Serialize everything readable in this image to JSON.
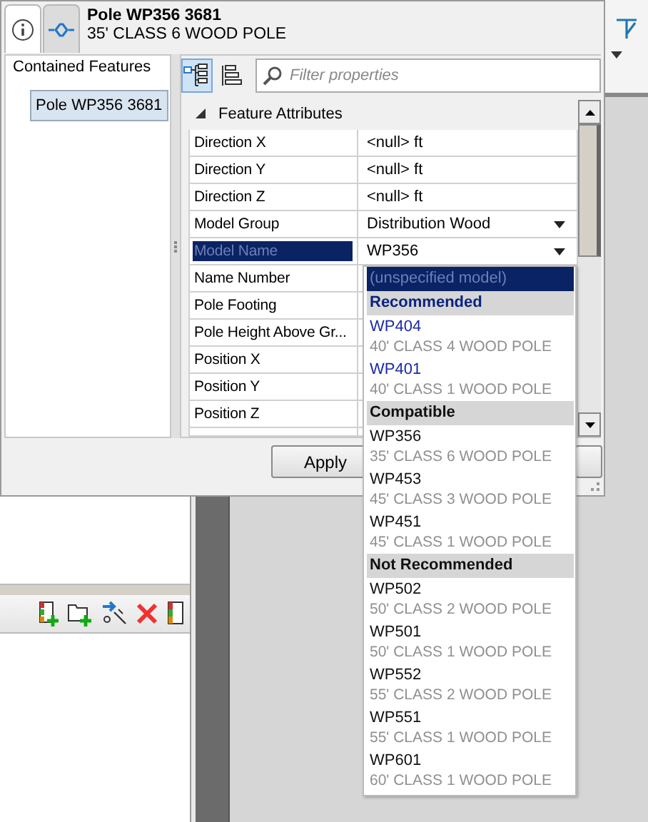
{
  "window": {
    "title": "Pole WP356 3681",
    "subtitle": "35' CLASS 6 WOOD POLE"
  },
  "tabs": [
    {
      "kind": "info",
      "selected": true
    },
    {
      "kind": "connection",
      "selected": false
    }
  ],
  "contained_features": {
    "title": "Contained Features",
    "items": [
      {
        "label": "Pole WP356 3681",
        "selected": true
      }
    ]
  },
  "view_buttons": [
    {
      "kind": "categorized",
      "selected": true
    },
    {
      "kind": "alphabetical",
      "selected": false
    }
  ],
  "filter": {
    "placeholder": "Filter properties"
  },
  "section": {
    "title": "Feature Attributes",
    "expanded": true
  },
  "properties": [
    {
      "name": "Direction X",
      "value": "<null> ft",
      "kind": "text",
      "selected": false
    },
    {
      "name": "Direction Y",
      "value": "<null> ft",
      "kind": "text",
      "selected": false
    },
    {
      "name": "Direction Z",
      "value": "<null> ft",
      "kind": "text",
      "selected": false
    },
    {
      "name": "Model Group",
      "value": "Distribution Wood",
      "kind": "dropdown",
      "selected": false
    },
    {
      "name": "Model Name",
      "value": "WP356",
      "kind": "dropdown",
      "selected": true
    },
    {
      "name": "Name Number",
      "kind": "text",
      "selected": false
    },
    {
      "name": "Pole Footing",
      "kind": "text",
      "selected": false
    },
    {
      "name": "Pole Height Above Gr...",
      "kind": "text",
      "selected": false
    },
    {
      "name": "Position X",
      "kind": "text",
      "selected": false
    },
    {
      "name": "Position Y",
      "kind": "text",
      "selected": false
    },
    {
      "name": "Position Z",
      "kind": "text",
      "selected": false
    }
  ],
  "buttons": [
    {
      "label": "Apply"
    }
  ],
  "dropdown": {
    "items": [
      {
        "kind": "option",
        "label": "(unspecified model)",
        "selected": true
      },
      {
        "kind": "header",
        "label": "Recommended",
        "recommended": true
      },
      {
        "kind": "model",
        "name": "WP404",
        "description": "40' CLASS 4 WOOD POLE",
        "recommended": true,
        "selected": false
      },
      {
        "kind": "model",
        "name": "WP401",
        "description": "40' CLASS 1 WOOD POLE",
        "recommended": true,
        "selected": false
      },
      {
        "kind": "header",
        "label": "Compatible",
        "recommended": false
      },
      {
        "kind": "model",
        "name": "WP356",
        "description": "35' CLASS 6 WOOD POLE",
        "recommended": false,
        "selected": false
      },
      {
        "kind": "model",
        "name": "WP453",
        "description": "45' CLASS 3 WOOD POLE",
        "recommended": false,
        "selected": false
      },
      {
        "kind": "model",
        "name": "WP451",
        "description": "45' CLASS 1 WOOD POLE",
        "recommended": false,
        "selected": false
      },
      {
        "kind": "header",
        "label": "Not Recommended",
        "recommended": false
      },
      {
        "kind": "model",
        "name": "WP502",
        "description": "50' CLASS 2 WOOD POLE",
        "recommended": false,
        "selected": false
      },
      {
        "kind": "model",
        "name": "WP501",
        "description": "50' CLASS 1 WOOD POLE",
        "recommended": false,
        "selected": false
      },
      {
        "kind": "model",
        "name": "WP552",
        "description": "55' CLASS 2 WOOD POLE",
        "recommended": false,
        "selected": false
      },
      {
        "kind": "model",
        "name": "WP551",
        "description": "55' CLASS 1 WOOD POLE",
        "recommended": false,
        "selected": false
      },
      {
        "kind": "model",
        "name": "WP601",
        "description": "60' CLASS 1 WOOD POLE",
        "recommended": false,
        "selected": false
      }
    ]
  }
}
